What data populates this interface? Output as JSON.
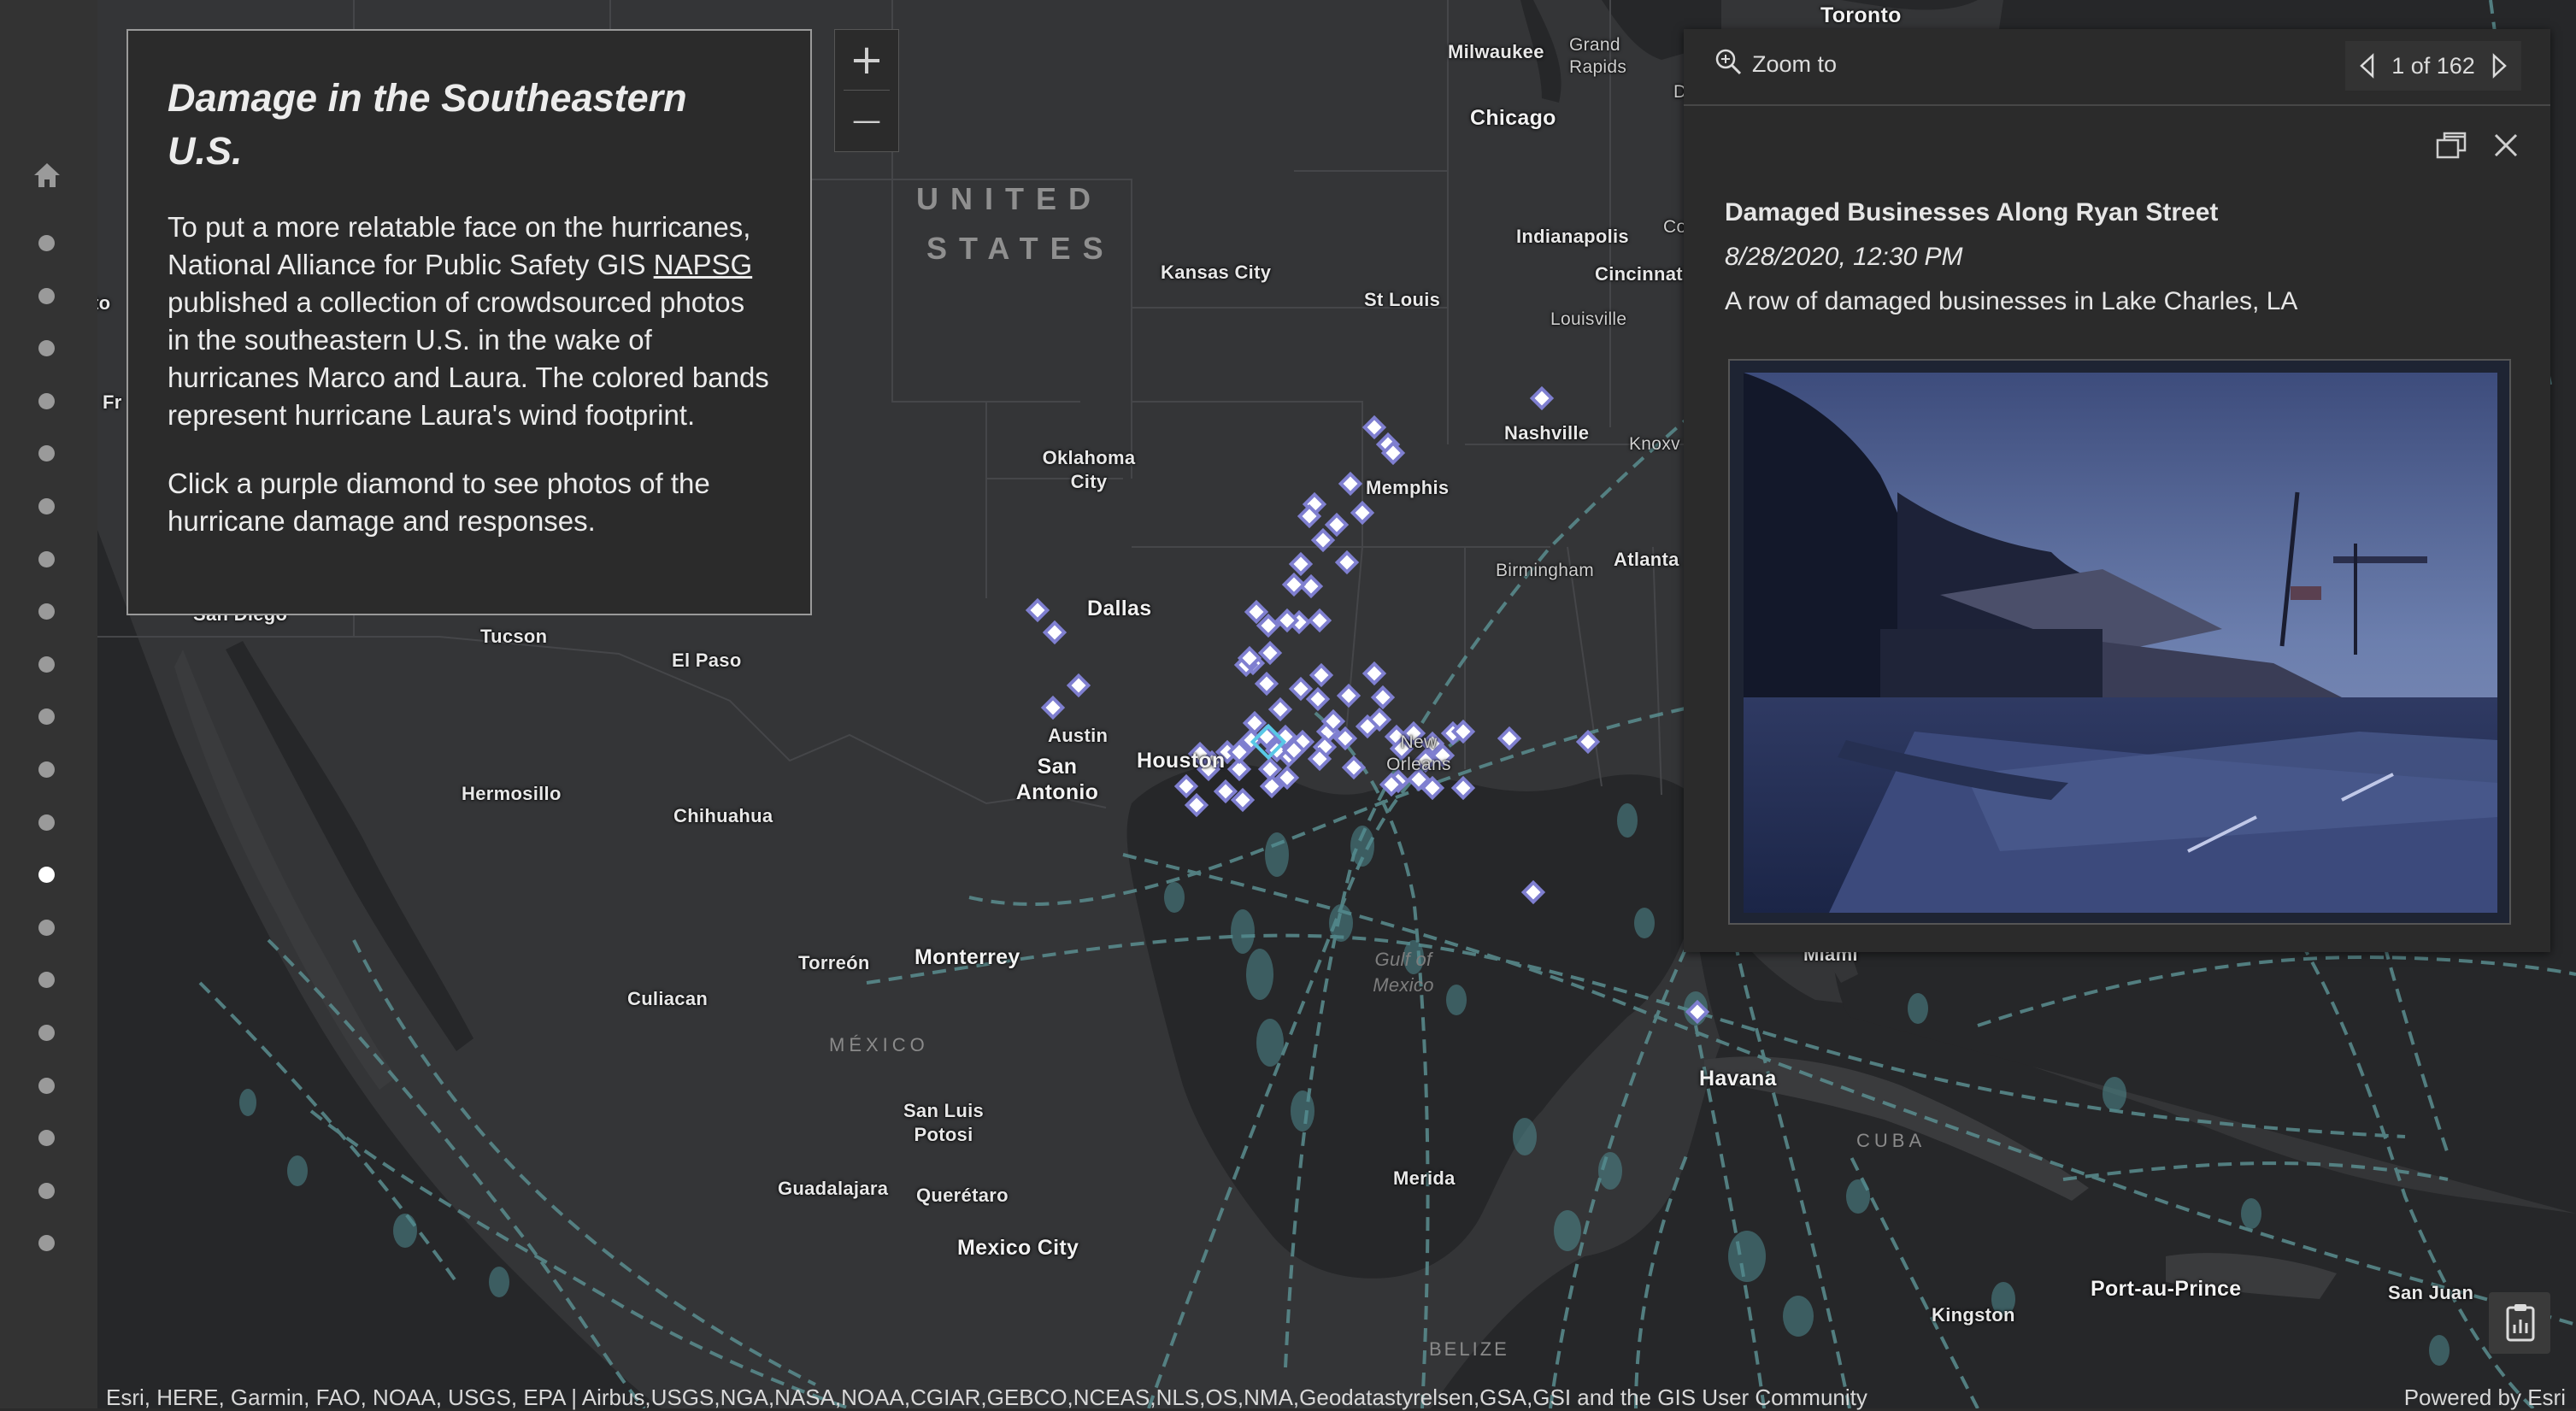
{
  "story": {
    "title": "Damage in the Southeastern U.S.",
    "paragraph1_before": "To put a more relatable face on the hurricanes, National Alliance for Public Safety GIS ",
    "link": "NAPSG",
    "paragraph1_after": " published a collection of crowdsourced photos in the southeastern U.S. in the wake of hurricanes Marco and Laura. The colored bands represent hurricane Laura's wind footprint.",
    "paragraph2": "Click a purple diamond to see photos of the hurricane damage and responses."
  },
  "sidebar": {
    "home_icon": "home-icon",
    "dot_count": 20,
    "active_index": 12
  },
  "zoom": {
    "in_label": "+",
    "out_label": "—"
  },
  "popup": {
    "zoom_to_label": "Zoom to",
    "pager": "1 of 162",
    "title": "Damaged Businesses Along Ryan Street",
    "date": "8/28/2020, 12:30 PM",
    "description": "A row of damaged businesses in Lake Charles, LA"
  },
  "map_labels": {
    "toronto": "Toronto",
    "milwaukee": "Milwaukee",
    "grand_rapids": "Grand Rapids",
    "chicago": "Chicago",
    "united": "UNITED",
    "states": "STATES",
    "kansas_city": "Kansas City",
    "st_louis": "St Louis",
    "indianapolis": "Indianapolis",
    "cincinnati": "Cincinnat",
    "louisville": "Louisville",
    "nashville": "Nashville",
    "knoxville": "Knoxv",
    "memphis": "Memphis",
    "oklahoma_city": "Oklahoma City",
    "dallas": "Dallas",
    "birmingham": "Birmingham",
    "atlanta": "Atlanta",
    "tucson": "Tucson",
    "el_paso": "El Paso",
    "san_diego": "San Diego",
    "austin": "Austin",
    "san_antonio": "San Antonio",
    "houston": "Houston",
    "new_orleans": "New Orleans",
    "hermosillo": "Hermosillo",
    "chihuahua": "Chihuahua",
    "torreon": "Torreón",
    "monterrey": "Monterrey",
    "culiacan": "Culiacan",
    "mexico": "MÉXICO",
    "gulf": "Gulf of Mexico",
    "miami": "Miami",
    "havana": "Havana",
    "cuba": "CUBA",
    "san_luis_potosi": "San Luis Potosi",
    "guadalajara": "Guadalajara",
    "queretaro": "Querétaro",
    "merida": "Merida",
    "mexico_city": "Mexico City",
    "belize": "BELIZE",
    "kingston": "Kingston",
    "port_au_prince": "Port-au-Prince",
    "san_juan": "San Juan",
    "co": "Co",
    "d": "D",
    "to": "to",
    "fr": "Fr"
  },
  "attribution": "Esri, HERE, Garmin, FAO, NOAA, USGS, EPA | Airbus,USGS,NGA,NASA,NOAA,CGIAR,GEBCO,NCEAS,NLS,OS,NMA,Geodatastyrelsen,GSA,GSI and the GIS User Community",
  "powered_by": "Powered by Esri",
  "colors": {
    "marker": "#7f7fd0",
    "marker_selected": "#59c8e6",
    "wind_band": "#4f8a8f",
    "panel": "#2b2b2b"
  },
  "icons": [
    "home-icon",
    "zoom-in-icon",
    "zoom-out-icon",
    "magnifier-icon",
    "chevron-left-icon",
    "chevron-right-icon",
    "dock-icon",
    "close-icon",
    "clipboard-chart-icon"
  ]
}
